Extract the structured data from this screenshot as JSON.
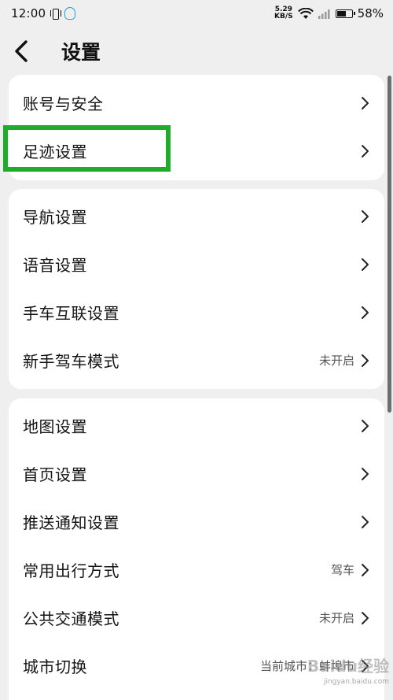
{
  "status_bar": {
    "time": "12:00",
    "net_speed_value": "5.29",
    "net_speed_unit": "KB/S",
    "battery": "58%"
  },
  "header": {
    "title": "设置"
  },
  "groups": [
    {
      "items": [
        {
          "label": "账号与安全",
          "value": ""
        },
        {
          "label": "足迹设置",
          "value": ""
        }
      ]
    },
    {
      "items": [
        {
          "label": "导航设置",
          "value": ""
        },
        {
          "label": "语音设置",
          "value": ""
        },
        {
          "label": "手车互联设置",
          "value": ""
        },
        {
          "label": "新手驾车模式",
          "value": "未开启"
        }
      ]
    },
    {
      "items": [
        {
          "label": "地图设置",
          "value": ""
        },
        {
          "label": "首页设置",
          "value": ""
        },
        {
          "label": "推送通知设置",
          "value": ""
        },
        {
          "label": "常用出行方式",
          "value": "驾车"
        },
        {
          "label": "公共交通模式",
          "value": "未开启"
        },
        {
          "label": "城市切换",
          "value": "当前城市：蚌埠市"
        }
      ]
    }
  ],
  "watermark": {
    "text": "Baidu经验",
    "sub": "jingyan.baidu.com"
  },
  "colors": {
    "highlight": "#1fac2a",
    "background": "#efefef",
    "card": "#ffffff"
  }
}
